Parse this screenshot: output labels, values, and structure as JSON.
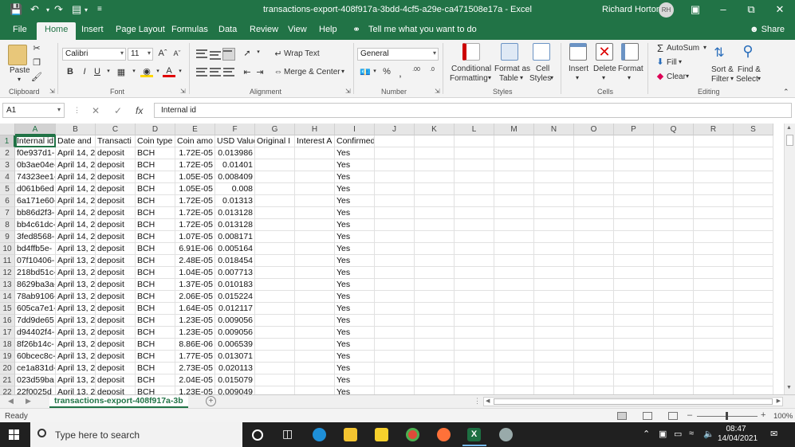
{
  "window": {
    "title": "transactions-export-408f917a-3bdd-4cf5-a29e-ca471508e17a  -  Excel",
    "user_name": "Richard Horton",
    "user_initials": "RH"
  },
  "tabs": [
    {
      "label": "File"
    },
    {
      "label": "Home"
    },
    {
      "label": "Insert"
    },
    {
      "label": "Page Layout"
    },
    {
      "label": "Formulas"
    },
    {
      "label": "Data"
    },
    {
      "label": "Review"
    },
    {
      "label": "View"
    },
    {
      "label": "Help"
    },
    {
      "label": "Tell me what you want to do"
    }
  ],
  "share_label": "Share",
  "ribbon": {
    "clipboard": {
      "paste": "Paste",
      "label": "Clipboard"
    },
    "font": {
      "name": "Calibri",
      "size": "11",
      "label": "Font"
    },
    "alignment": {
      "wrap_text": "Wrap Text",
      "merge_center": "Merge & Center",
      "label": "Alignment"
    },
    "number": {
      "format": "General",
      "label": "Number"
    },
    "styles": {
      "conditional": "Conditional",
      "formatting": "Formatting",
      "format_as": "Format as",
      "table": "Table",
      "cell": "Cell",
      "cell_styles": "Styles",
      "label": "Styles"
    },
    "cells": {
      "insert": "Insert",
      "delete": "Delete",
      "format": "Format",
      "label": "Cells"
    },
    "editing": {
      "autosum": "AutoSum",
      "fill": "Fill",
      "clear": "Clear",
      "sort": "Sort &",
      "filter": "Filter",
      "find": "Find &",
      "select": "Select",
      "label": "Editing"
    }
  },
  "formula_bar": {
    "cell_ref": "A1",
    "fx": "fx",
    "content": "Internal id"
  },
  "columns": [
    "A",
    "B",
    "C",
    "D",
    "E",
    "F",
    "G",
    "H",
    "I",
    "J",
    "K",
    "L",
    "M",
    "N",
    "O",
    "P",
    "Q",
    "R",
    "S"
  ],
  "headers": [
    "Internal id",
    "Date and",
    "Transacti",
    "Coin type",
    "Coin amo",
    "USD Value",
    "Original I",
    "Interest A",
    "Confirmed"
  ],
  "rows": [
    [
      "f0e937d1-",
      "April 14, 2",
      "deposit",
      "BCH",
      "1.72E-05",
      "0.013986",
      "",
      "",
      "Yes"
    ],
    [
      "0b3ae04e-",
      "April 14, 2",
      "deposit",
      "BCH",
      "1.72E-05",
      "0.01401",
      "",
      "",
      "Yes"
    ],
    [
      "74323ee1-",
      "April 14, 2",
      "deposit",
      "BCH",
      "1.05E-05",
      "0.008409",
      "",
      "",
      "Yes"
    ],
    [
      "d061b6ed",
      "April 14, 2",
      "deposit",
      "BCH",
      "1.05E-05",
      "0.008",
      "",
      "",
      "Yes"
    ],
    [
      "6a171e60-",
      "April 14, 2",
      "deposit",
      "BCH",
      "1.72E-05",
      "0.01313",
      "",
      "",
      "Yes"
    ],
    [
      "bb86d2f3-",
      "April 14, 2",
      "deposit",
      "BCH",
      "1.72E-05",
      "0.013128",
      "",
      "",
      "Yes"
    ],
    [
      "bb4c61dc-",
      "April 14, 2",
      "deposit",
      "BCH",
      "1.72E-05",
      "0.013128",
      "",
      "",
      "Yes"
    ],
    [
      "3fed8568-",
      "April 14, 2",
      "deposit",
      "BCH",
      "1.07E-05",
      "0.008171",
      "",
      "",
      "Yes"
    ],
    [
      "bd4ffb5e-",
      "April 13, 2",
      "deposit",
      "BCH",
      "6.91E-06",
      "0.005164",
      "",
      "",
      "Yes"
    ],
    [
      "07f10406-",
      "April 13, 2",
      "deposit",
      "BCH",
      "2.48E-05",
      "0.018454",
      "",
      "",
      "Yes"
    ],
    [
      "218bd51c-",
      "April 13, 2",
      "deposit",
      "BCH",
      "1.04E-05",
      "0.007713",
      "",
      "",
      "Yes"
    ],
    [
      "8629ba3a-",
      "April 13, 2",
      "deposit",
      "BCH",
      "1.37E-05",
      "0.010183",
      "",
      "",
      "Yes"
    ],
    [
      "78ab9106-",
      "April 13, 2",
      "deposit",
      "BCH",
      "2.06E-05",
      "0.015224",
      "",
      "",
      "Yes"
    ],
    [
      "605ca7e1-",
      "April 13, 2",
      "deposit",
      "BCH",
      "1.64E-05",
      "0.012117",
      "",
      "",
      "Yes"
    ],
    [
      "7dd9de65",
      "April 13, 2",
      "deposit",
      "BCH",
      "1.23E-05",
      "0.009056",
      "",
      "",
      "Yes"
    ],
    [
      "d94402f4-",
      "April 13, 2",
      "deposit",
      "BCH",
      "1.23E-05",
      "0.009056",
      "",
      "",
      "Yes"
    ],
    [
      "8f26b14c-",
      "April 13, 2",
      "deposit",
      "BCH",
      "8.86E-06",
      "0.006539",
      "",
      "",
      "Yes"
    ],
    [
      "60bcec8c-",
      "April 13, 2",
      "deposit",
      "BCH",
      "1.77E-05",
      "0.013071",
      "",
      "",
      "Yes"
    ],
    [
      "ce1a831d-",
      "April 13, 2",
      "deposit",
      "BCH",
      "2.73E-05",
      "0.020113",
      "",
      "",
      "Yes"
    ],
    [
      "023d59ba",
      "April 13, 2",
      "deposit",
      "BCH",
      "2.04E-05",
      "0.015079",
      "",
      "",
      "Yes"
    ],
    [
      "22f0025d",
      "April 13, 2",
      "deposit",
      "BCH",
      "1.23E-05",
      "0.009049",
      "",
      "",
      "Yes"
    ]
  ],
  "sheet_tab": "transactions-export-408f917a-3b",
  "status": {
    "ready": "Ready",
    "zoom": "100%"
  },
  "taskbar": {
    "search_placeholder": "Type here to search",
    "time": "08:47",
    "date": "14/04/2021"
  }
}
